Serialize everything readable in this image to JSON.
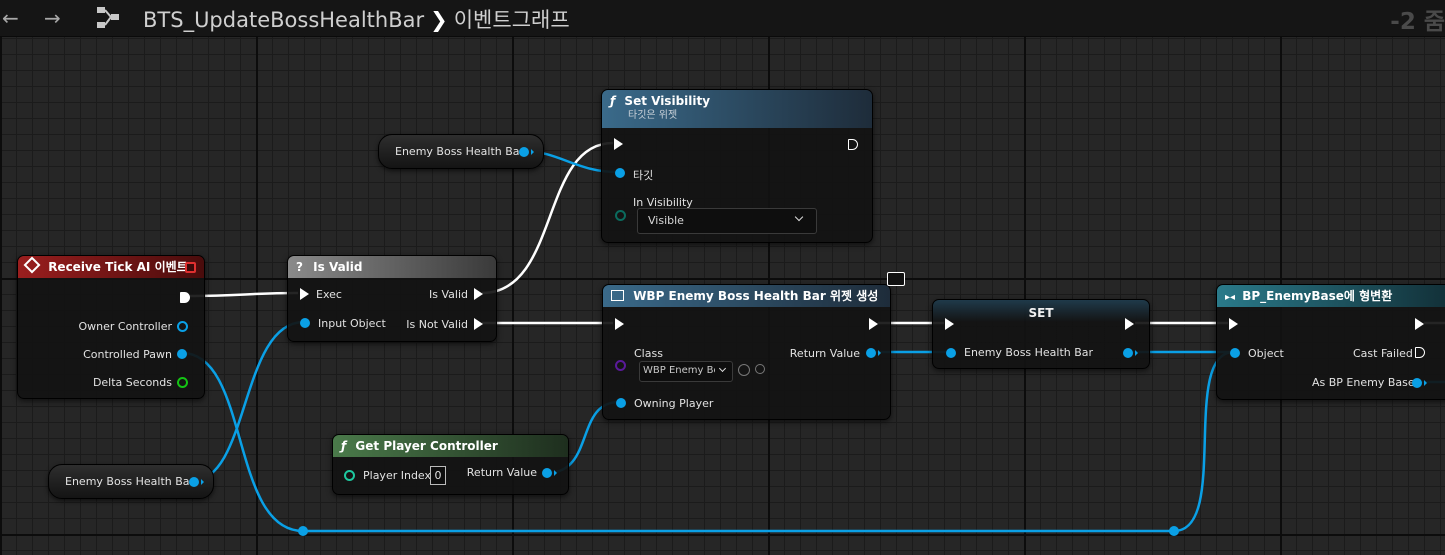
{
  "toolbar": {
    "back_icon": "back-arrow-icon",
    "forward_icon": "forward-arrow-icon",
    "graph_icon": "graph-hierarchy-icon",
    "breadcrumb_asset": "BTS_UpdateBossHealthBar",
    "breadcrumb_graph": "이벤트그래프",
    "zoom_text": "-2 줌"
  },
  "colors": {
    "event_header": "#8a1a1a",
    "function_header": "#2f4d66",
    "macro_header": "#6b6b6b",
    "pure_header": "#3a5a3a",
    "object_pin": "#0aa0e6",
    "class_pin": "#5a1a9a",
    "struct_pin": "#14c414",
    "enum_pin": "#0b6b5e"
  },
  "nodes": {
    "receive_tick": {
      "title": "Receive Tick AI 이벤트",
      "pins": [
        "Owner Controller",
        "Controlled Pawn",
        "Delta Seconds"
      ]
    },
    "is_valid": {
      "title": "Is Valid",
      "exec_in": "Exec",
      "input": "Input Object",
      "out_valid": "Is Valid",
      "out_not_valid": "Is Not Valid"
    },
    "set_visibility": {
      "title": "Set Visibility",
      "subtitle": "타깃은 위젯",
      "target": "타깃",
      "in_visibility": "In Visibility",
      "visibility_value": "Visible"
    },
    "create_widget": {
      "title": "WBP Enemy Boss Health Bar 위젯 생성",
      "class_label": "Class",
      "class_value": "WBP Enemy Bos",
      "return_value": "Return Value",
      "owning_player": "Owning Player"
    },
    "get_player_controller": {
      "title": "Get Player Controller",
      "player_index": "Player Index",
      "player_index_value": "0",
      "return_value": "Return Value"
    },
    "set_var": {
      "title": "SET",
      "pin": "Enemy Boss Health Bar"
    },
    "cast": {
      "title": "BP_EnemyBase에 형변환",
      "object": "Object",
      "cast_failed": "Cast Failed",
      "as_output": "As BP Enemy Base"
    },
    "var_top": {
      "label": "Enemy Boss Health Bar"
    },
    "var_bottom": {
      "label": "Enemy Boss Health Bar"
    }
  }
}
